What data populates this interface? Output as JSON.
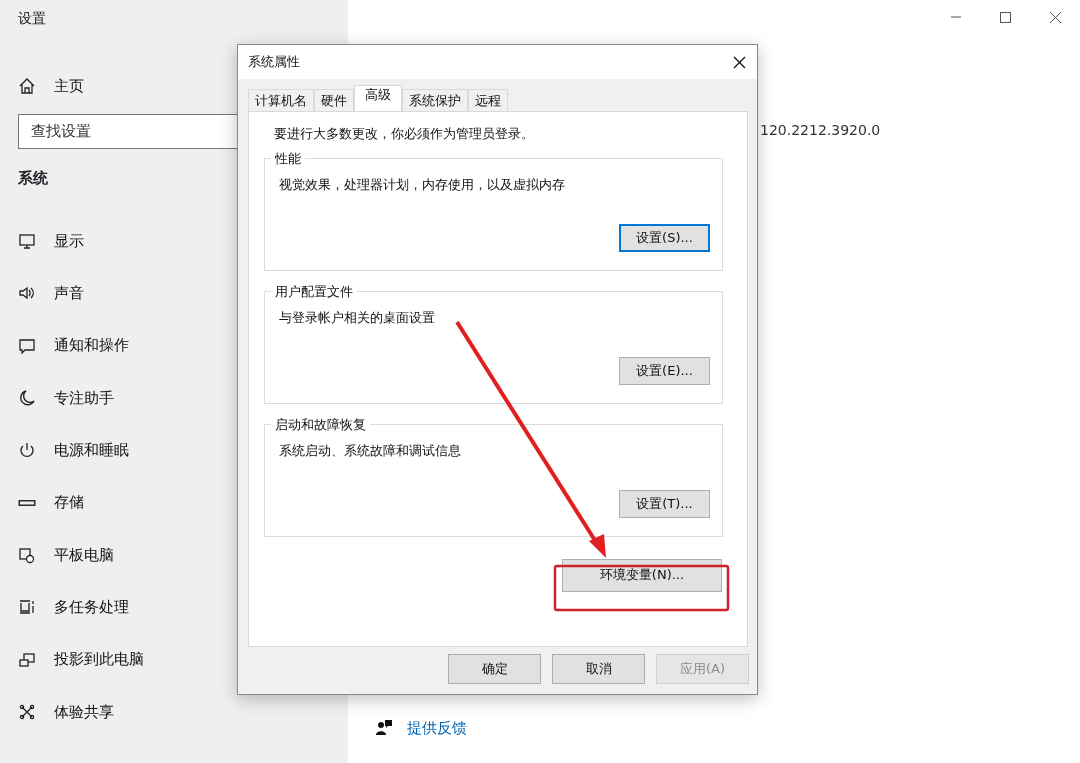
{
  "settings": {
    "title": "设置",
    "home": "主页",
    "search": {
      "placeholder": "查找设置"
    },
    "section": "系统",
    "nav_items": [
      {
        "label": "显示"
      },
      {
        "label": "声音"
      },
      {
        "label": "通知和操作"
      },
      {
        "label": "专注助手"
      },
      {
        "label": "电源和睡眠"
      },
      {
        "label": "存储"
      },
      {
        "label": "平板电脑"
      },
      {
        "label": "多任务处理"
      },
      {
        "label": "投影到此电脑"
      },
      {
        "label": "体验共享"
      }
    ],
    "version": "120.2212.3920.0",
    "feedback_link": "提供反馈"
  },
  "dialog": {
    "title": "系统属性",
    "tabs": [
      {
        "label": "计算机名",
        "selected": false
      },
      {
        "label": "硬件",
        "selected": false
      },
      {
        "label": "高级",
        "selected": true
      },
      {
        "label": "系统保护",
        "selected": false
      },
      {
        "label": "远程",
        "selected": false
      }
    ],
    "notice": "要进行大多数更改，你必须作为管理员登录。",
    "groups": [
      {
        "title": "性能",
        "description": "视觉效果，处理器计划，内存使用，以及虚拟内存",
        "button": "设置(S)...",
        "default": true
      },
      {
        "title": "用户配置文件",
        "description": "与登录帐户相关的桌面设置",
        "button": "设置(E)...",
        "default": false
      },
      {
        "title": "启动和故障恢复",
        "description": "系统启动、系统故障和调试信息",
        "button": "设置(T)...",
        "default": false
      }
    ],
    "env_button": "环境变量(N)...",
    "footer_buttons": [
      {
        "label": "确定",
        "disabled": false
      },
      {
        "label": "取消",
        "disabled": false
      },
      {
        "label": "应用(A)",
        "disabled": true
      }
    ]
  }
}
